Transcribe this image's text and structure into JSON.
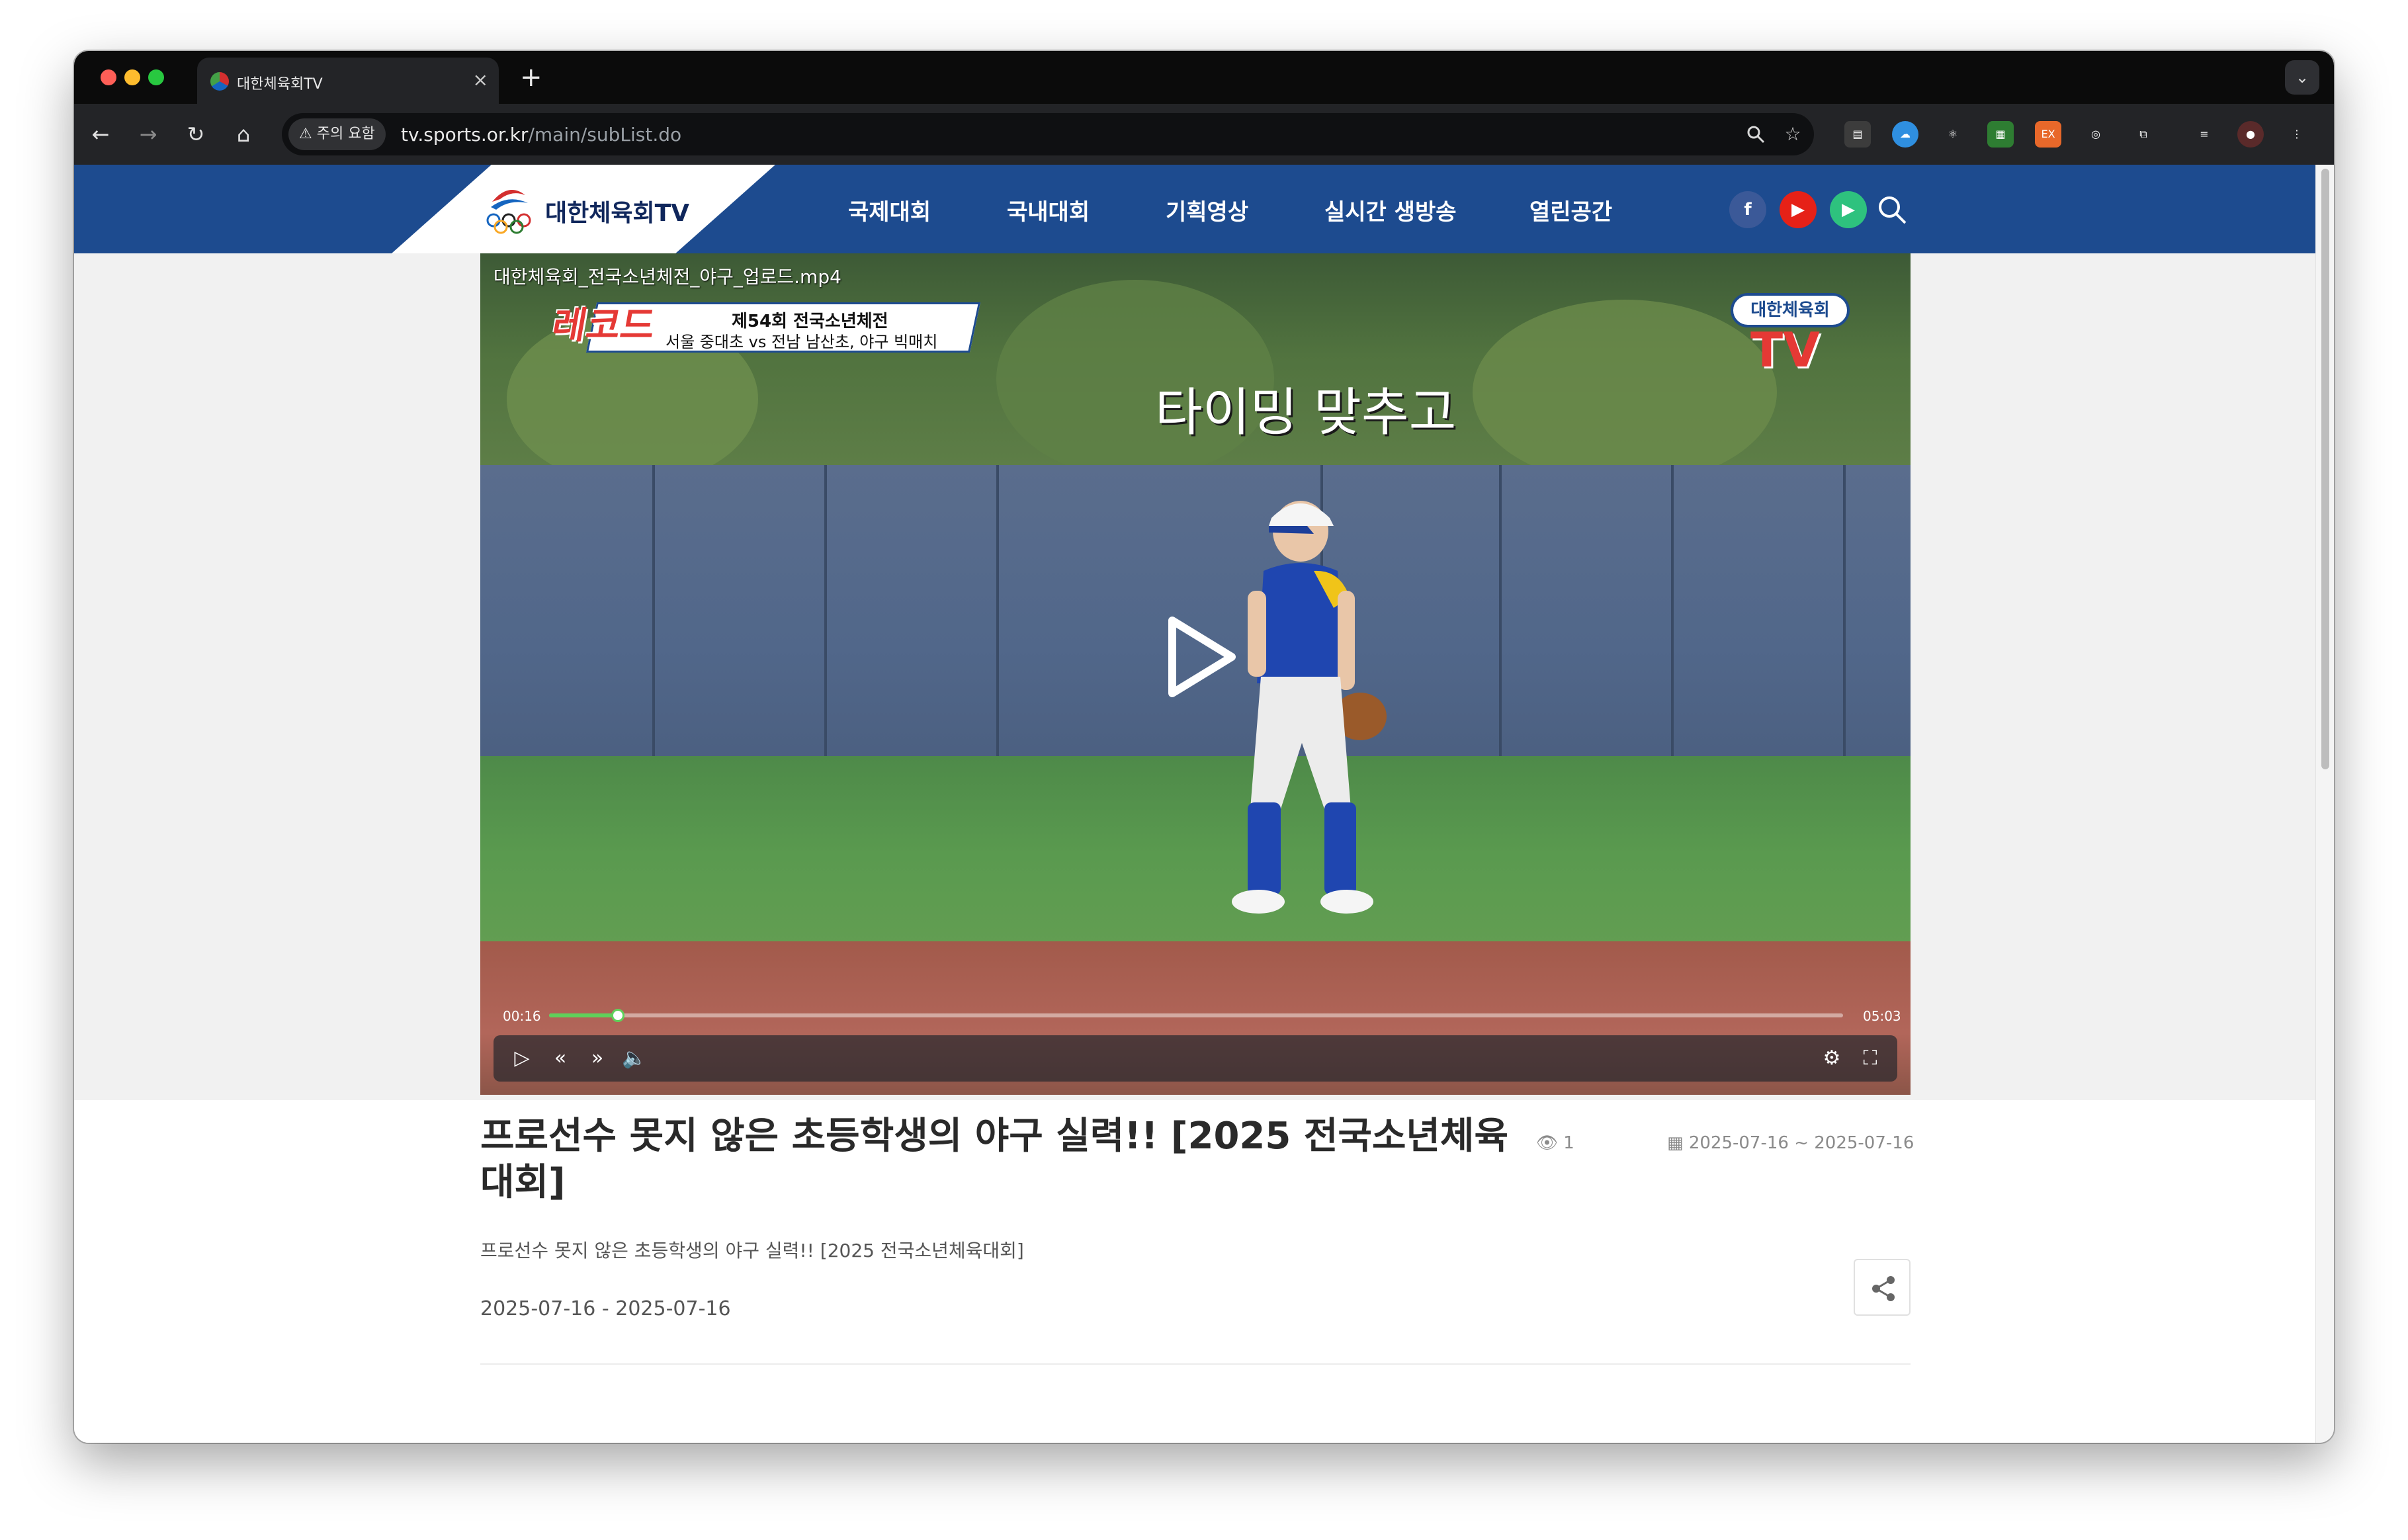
{
  "browser": {
    "tab_title": "대한체육회TV",
    "tab_close": "×",
    "new_tab": "+",
    "security_chip": "주의 요함",
    "url_host": "tv.sports.or.kr",
    "url_path": "/main/subList.do",
    "colors": {
      "close": "#ff5f57",
      "minimize": "#febc2e",
      "zoom": "#28c840"
    }
  },
  "site": {
    "logo_text": "대한체육회TV",
    "nav": [
      "국제대회",
      "국내대회",
      "기획영상",
      "실시간 생방송",
      "열린공간"
    ],
    "social": [
      {
        "icon": "facebook-icon",
        "glyph": "f",
        "color": "#3b5998"
      },
      {
        "icon": "youtube-icon",
        "glyph": "▶",
        "color": "#e62117"
      },
      {
        "icon": "play-store-icon",
        "glyph": "▶",
        "color": "#2ec27e"
      }
    ],
    "header_color": "#1d4b8f"
  },
  "video": {
    "filename": "대한체육회_전국소년체전_야구_업로드.mp4",
    "overlay_brand": "레코드",
    "overlay_title": "제54회 전국소년체전",
    "overlay_subtitle": "서울 중대초 vs 전남 남산초, 야구 빅매치",
    "caption": "타이밍 맞추고",
    "watermark_top": "대한체육회",
    "watermark_bottom": "TV",
    "current_time": "00:16",
    "duration": "05:03",
    "progress": 0.053
  },
  "content": {
    "title": "프로선수 못지 않은 초등학생의 야구 실력!!  [2025 전국소년체육대회]",
    "views": "1",
    "date_range": "2025-07-16 ~ 2025-07-16",
    "description": "프로선수 못지 않은 초등학생의 야구 실력!!  [2025 전국소년체육대회]",
    "dates_line": "2025-07-16 -  2025-07-16"
  }
}
